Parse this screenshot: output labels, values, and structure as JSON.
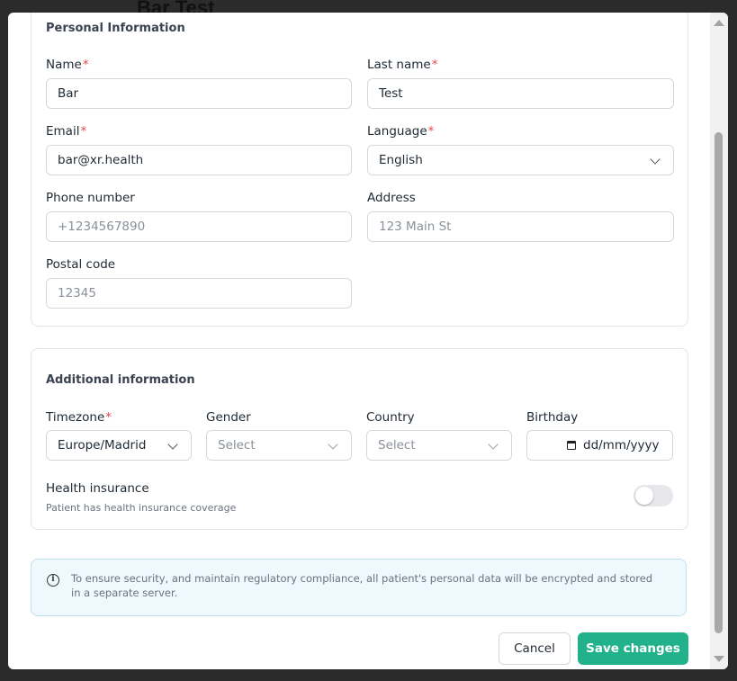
{
  "background": {
    "title": "Bar Test"
  },
  "personal": {
    "title": "Personal Information",
    "name": {
      "label": "Name",
      "value": "Bar"
    },
    "last_name": {
      "label": "Last name",
      "value": "Test"
    },
    "email": {
      "label": "Email",
      "value": "bar@xr.health"
    },
    "language": {
      "label": "Language",
      "value": "English"
    },
    "phone": {
      "label": "Phone number",
      "placeholder": "+1234567890"
    },
    "address": {
      "label": "Address",
      "placeholder": "123 Main St"
    },
    "postal": {
      "label": "Postal code",
      "placeholder": "12345"
    },
    "required_mark": "*"
  },
  "additional": {
    "title": "Additional information",
    "timezone": {
      "label": "Timezone",
      "value": "Europe/Madrid"
    },
    "gender": {
      "label": "Gender",
      "placeholder": "Select"
    },
    "country": {
      "label": "Country",
      "placeholder": "Select"
    },
    "birthday": {
      "label": "Birthday",
      "placeholder": "dd/mm/yyyy"
    },
    "health_insurance": {
      "label": "Health insurance",
      "hint": "Patient has health insurance coverage",
      "enabled": false
    }
  },
  "notice": {
    "icon": "info-icon",
    "glyph": "i",
    "text": "To ensure security, and maintain regulatory compliance, all patient's personal data will be encrypted and stored in a separate server."
  },
  "actions": {
    "cancel": "Cancel",
    "save": "Save changes"
  },
  "colors": {
    "primary": "#22b28b",
    "required": "#e5484d",
    "notice_bg": "#eff8fc"
  }
}
